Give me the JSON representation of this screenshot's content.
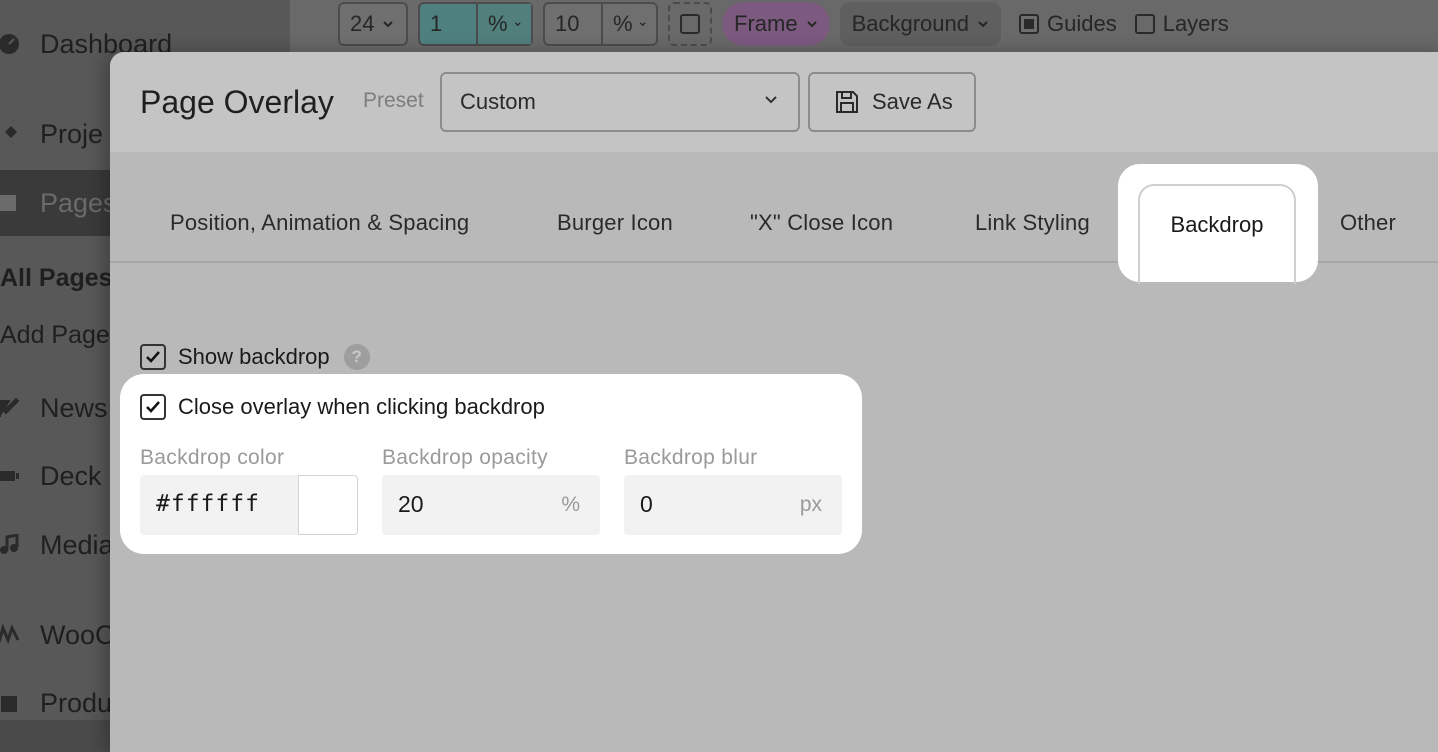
{
  "sidebar": {
    "items": [
      {
        "label": "Dashboard",
        "icon": "dashboard-icon"
      },
      {
        "label": "Proje",
        "icon": "pin-icon"
      },
      {
        "label": "Pages",
        "icon": "pages-icon"
      },
      {
        "label": "News",
        "icon": "edit-icon"
      },
      {
        "label": "Deck",
        "icon": "deck-icon"
      },
      {
        "label": "Media",
        "icon": "media-icon"
      },
      {
        "label": "WooC",
        "icon": "woo-icon"
      },
      {
        "label": "Produ",
        "icon": "product-icon"
      }
    ],
    "sub_items": [
      "All Pages",
      "Add Page"
    ]
  },
  "toolbar": {
    "size_value": "24",
    "spacing_value": "1",
    "spacing_unit": "%",
    "width_value": "10",
    "width_unit": "%",
    "frame_label": "Frame",
    "background_label": "Background",
    "guides_label": "Guides",
    "layers_label": "Layers"
  },
  "modal": {
    "title": "Page Overlay",
    "preset_label": "Preset",
    "preset_value": "Custom",
    "save_as_label": "Save As",
    "tabs": [
      {
        "label": "Position, Animation & Spacing"
      },
      {
        "label": "Burger Icon"
      },
      {
        "label": "\"X\" Close Icon"
      },
      {
        "label": "Link Styling"
      },
      {
        "label": "Backdrop"
      },
      {
        "label": "Other"
      }
    ],
    "active_tab": "Backdrop",
    "show_backdrop_label": "Show backdrop",
    "show_backdrop_checked": true,
    "close_on_click_label": "Close overlay when clicking backdrop",
    "close_on_click_checked": true,
    "fields": {
      "color": {
        "label": "Backdrop color",
        "value": "#ffffff"
      },
      "opacity": {
        "label": "Backdrop opacity",
        "value": "20",
        "unit": "%"
      },
      "blur": {
        "label": "Backdrop blur",
        "value": "0",
        "unit": "px"
      }
    }
  },
  "colors": {
    "modal_bg": "#b9b9b9",
    "highlight": "#ffffff",
    "swatch": "#ffffff"
  }
}
